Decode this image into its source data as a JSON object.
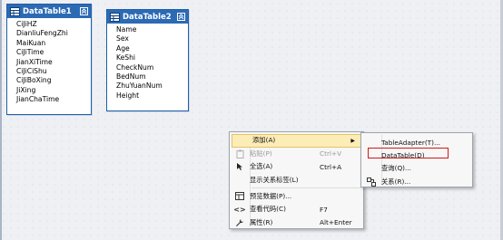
{
  "table1": {
    "title": "DataTable1",
    "columns": [
      "CiJiHZ",
      "DianliuFengZhi",
      "MaiKuan",
      "CiJiTime",
      "JianXiTime",
      "CiJiCiShu",
      "CiJiBoXing",
      "JiXing",
      "JianChaTime"
    ]
  },
  "table2": {
    "title": "DataTable2",
    "columns": [
      "Name",
      "Sex",
      "Age",
      "KeShi",
      "CheckNum",
      "BedNum",
      "ZhuYuanNum",
      "Height"
    ]
  },
  "context_menu": {
    "items": [
      {
        "label": "添加(A)",
        "shortcut": "",
        "icon": "",
        "submenu": true,
        "enabled": true
      },
      {
        "label": "粘贴(P)",
        "shortcut": "Ctrl+V",
        "icon": "paste-icon",
        "enabled": false
      },
      {
        "label": "全选(A)",
        "shortcut": "Ctrl+A",
        "icon": "select-all-icon",
        "enabled": true
      },
      {
        "label": "显示关系标签(L)",
        "shortcut": "",
        "icon": "",
        "enabled": true
      },
      {
        "label": "预览数据(P)...",
        "shortcut": "",
        "icon": "preview-data-icon",
        "enabled": true
      },
      {
        "label": "查看代码(C)",
        "shortcut": "F7",
        "icon": "view-code-icon",
        "enabled": true
      },
      {
        "label": "属性(R)",
        "shortcut": "Alt+Enter",
        "icon": "properties-icon",
        "enabled": true
      }
    ]
  },
  "submenu": {
    "items": [
      {
        "label": "TableAdapter(T)...",
        "icon": ""
      },
      {
        "label": "DataTable(D)",
        "icon": ""
      },
      {
        "label": "查询(Q)...",
        "icon": ""
      },
      {
        "label": "关系(R)...",
        "icon": "relation-icon"
      }
    ]
  },
  "colors": {
    "table_header": "#2c6ab4",
    "highlight": "#fcecb6",
    "focus_outline": "#d21a1a"
  }
}
